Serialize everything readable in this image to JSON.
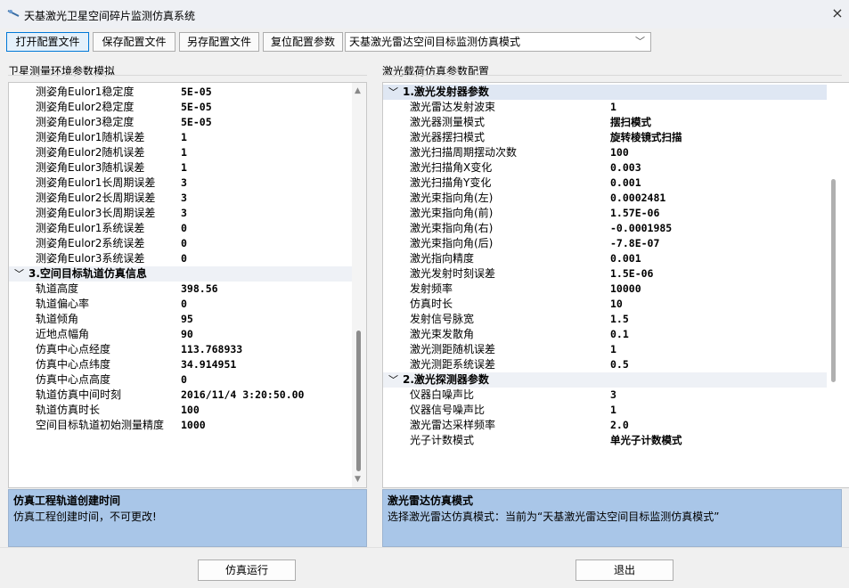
{
  "window": {
    "title": "天基激光卫星空间碎片监测仿真系统",
    "close_glyph": "×"
  },
  "toolbar": {
    "open_config": "打开配置文件",
    "save_config": "保存配置文件",
    "save_as_config": "另存配置文件",
    "reset_config": "复位配置参数",
    "mode_selected": "天基激光雷达空间目标监测仿真模式"
  },
  "left_panel": {
    "title": "卫星测量环境参数模拟",
    "rows": [
      {
        "name": "测姿角Eulor1稳定度",
        "value": "5E-05"
      },
      {
        "name": "测姿角Eulor2稳定度",
        "value": "5E-05"
      },
      {
        "name": "测姿角Eulor3稳定度",
        "value": "5E-05"
      },
      {
        "name": "测姿角Eulor1随机误差",
        "value": "1"
      },
      {
        "name": "测姿角Eulor2随机误差",
        "value": "1"
      },
      {
        "name": "测姿角Eulor3随机误差",
        "value": "1"
      },
      {
        "name": "测姿角Eulor1长周期误差",
        "value": "3"
      },
      {
        "name": "测姿角Eulor2长周期误差",
        "value": "3"
      },
      {
        "name": "测姿角Eulor3长周期误差",
        "value": "3"
      },
      {
        "name": "测姿角Eulor1系统误差",
        "value": "0"
      },
      {
        "name": "测姿角Eulor2系统误差",
        "value": "0"
      },
      {
        "name": "测姿角Eulor3系统误差",
        "value": "0"
      },
      {
        "category": "3.空间目标轨道仿真信息"
      },
      {
        "name": "轨道高度",
        "value": "398.56"
      },
      {
        "name": "轨道偏心率",
        "value": "0"
      },
      {
        "name": "轨道倾角",
        "value": "95"
      },
      {
        "name": "近地点幅角",
        "value": "90"
      },
      {
        "name": "仿真中心点经度",
        "value": "113.768933"
      },
      {
        "name": "仿真中心点纬度",
        "value": "34.914951"
      },
      {
        "name": "仿真中心点高度",
        "value": "0"
      },
      {
        "name": "轨道仿真中间时刻",
        "value": "2016/11/4 3:20:50.00"
      },
      {
        "name": "轨道仿真时长",
        "value": "100"
      },
      {
        "name": "空间目标轨道初始测量精度",
        "value": "1000"
      }
    ],
    "desc_title": "仿真工程轨道创建时间",
    "desc_text": "仿真工程创建时间，不可更改!"
  },
  "right_panel": {
    "title": "激光载荷仿真参数配置",
    "rows": [
      {
        "category": "1.激光发射器参数"
      },
      {
        "name": "激光雷达发射波束",
        "value": "1"
      },
      {
        "name": "激光器测量模式",
        "value": "摆扫模式"
      },
      {
        "name": "激光器摆扫模式",
        "value": "旋转棱镜式扫描"
      },
      {
        "name": "激光扫描周期摆动次数",
        "value": "100"
      },
      {
        "name": "激光扫描角X变化",
        "value": "0.003"
      },
      {
        "name": "激光扫描角Y变化",
        "value": "0.001"
      },
      {
        "name": "激光束指向角(左)",
        "value": "0.0002481"
      },
      {
        "name": "激光束指向角(前)",
        "value": "1.57E-06"
      },
      {
        "name": "激光束指向角(右)",
        "value": "-0.0001985"
      },
      {
        "name": "激光束指向角(后)",
        "value": "-7.8E-07"
      },
      {
        "name": "激光指向精度",
        "value": "0.001"
      },
      {
        "name": "激光发射时刻误差",
        "value": "1.5E-06"
      },
      {
        "name": "发射频率",
        "value": "10000"
      },
      {
        "name": "仿真时长",
        "value": "10"
      },
      {
        "name": "发射信号脉宽",
        "value": "1.5"
      },
      {
        "name": "激光束发散角",
        "value": "0.1"
      },
      {
        "name": "激光测距随机误差",
        "value": "1"
      },
      {
        "name": "激光测距系统误差",
        "value": "0.5"
      },
      {
        "category": "2.激光探测器参数"
      },
      {
        "name": "仪器白噪声比",
        "value": "3"
      },
      {
        "name": "仪器信号噪声比",
        "value": "1"
      },
      {
        "name": "激光雷达采样频率",
        "value": "2.0"
      },
      {
        "name": "光子计数模式",
        "value": "单光子计数模式"
      }
    ],
    "desc_title": "激光雷达仿真模式",
    "desc_text": "选择激光雷达仿真模式：当前为“天基激光雷达空间目标监测仿真模式”"
  },
  "buttons": {
    "run": "仿真运行",
    "exit": "退出"
  }
}
